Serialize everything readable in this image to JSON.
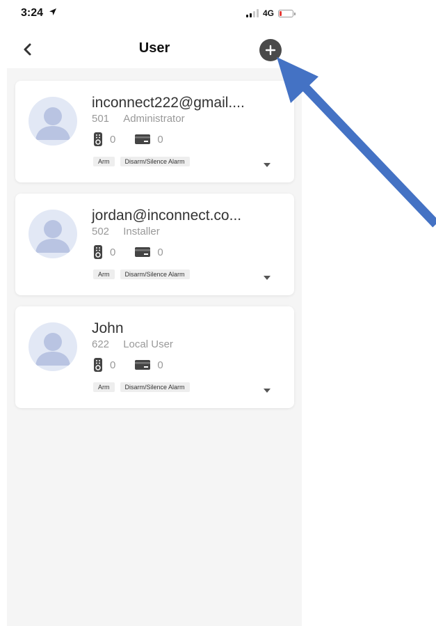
{
  "status_bar": {
    "time": "3:24",
    "network": "4G"
  },
  "header": {
    "title": "User"
  },
  "users": [
    {
      "email": "inconnect222@gmail....",
      "id": "501",
      "role": "Administrator",
      "remote_count": "0",
      "card_count": "0",
      "permissions": [
        "Arm",
        "Disarm/Silence Alarm"
      ]
    },
    {
      "email": "jordan@inconnect.co...",
      "id": "502",
      "role": "Installer",
      "remote_count": "0",
      "card_count": "0",
      "permissions": [
        "Arm",
        "Disarm/Silence Alarm"
      ]
    },
    {
      "email": "John",
      "id": "622",
      "role": "Local User",
      "remote_count": "0",
      "card_count": "0",
      "permissions": [
        "Arm",
        "Disarm/Silence Alarm"
      ]
    }
  ],
  "icons": {
    "back": "chevron-left-icon",
    "add": "plus-icon",
    "remote": "remote-control-icon",
    "card": "card-icon",
    "expand": "caret-down-icon",
    "avatar": "user-silhouette-icon"
  },
  "colors": {
    "annotation_arrow": "#4472c4",
    "add_button": "#4a4a4a",
    "battery_low": "#e53935",
    "page_background": "#f5f5f5"
  }
}
